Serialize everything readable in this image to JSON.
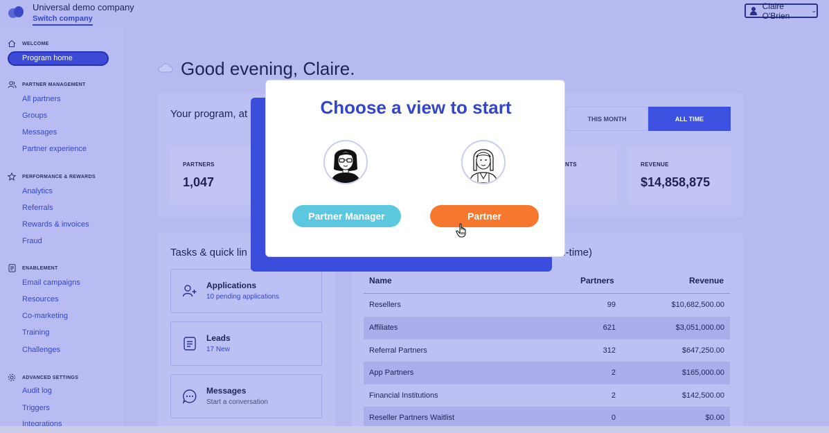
{
  "header": {
    "company_name": "Universal demo company",
    "switch_company": "Switch company",
    "user_name": "Claire O'Brien"
  },
  "sidebar": {
    "sections": [
      {
        "heading": "WELCOME",
        "icon": "home-icon",
        "items": [
          "Program home"
        ]
      },
      {
        "heading": "PARTNER MANAGEMENT",
        "icon": "users-icon",
        "items": [
          "All partners",
          "Groups",
          "Messages",
          "Partner experience"
        ]
      },
      {
        "heading": "PERFORMANCE & REWARDS",
        "icon": "star-icon",
        "items": [
          "Analytics",
          "Referrals",
          "Rewards & invoices",
          "Fraud"
        ]
      },
      {
        "heading": "ENABLEMENT",
        "icon": "document-icon",
        "items": [
          "Email campaigns",
          "Resources",
          "Co-marketing",
          "Training",
          "Challenges"
        ]
      },
      {
        "heading": "ADVANCED SETTINGS",
        "icon": "gear-icon",
        "items": [
          "Audit log",
          "Triggers",
          "Integrations"
        ]
      }
    ]
  },
  "main": {
    "greeting": "Good evening, Claire.",
    "program_title": "Your program, at",
    "tabs": {
      "month": "THIS MONTH",
      "all_time": "ALL TIME"
    },
    "stats": {
      "partners_label": "PARTNERS",
      "partners_value": "1,047",
      "clients_label": "NTS",
      "revenue_label": "REVENUE",
      "revenue_value": "$14,858,875"
    },
    "tasks_title": "Tasks & quick lin",
    "tasks": [
      {
        "title": "Applications",
        "sub": "10 pending applications",
        "icon": "add-user-icon"
      },
      {
        "title": "Leads",
        "sub": "17 New",
        "icon": "document-icon"
      },
      {
        "title": "Messages",
        "sub": "Start a conversation",
        "icon": "chat-icon"
      }
    ],
    "table_title": "ll-time)",
    "table": {
      "headers": {
        "name": "Name",
        "partners": "Partners",
        "revenue": "Revenue"
      },
      "rows": [
        {
          "name": "Resellers",
          "partners": "99",
          "revenue": "$10,682,500.00"
        },
        {
          "name": "Affiliates",
          "partners": "621",
          "revenue": "$3,051,000.00"
        },
        {
          "name": "Referral Partners",
          "partners": "312",
          "revenue": "$647,250.00"
        },
        {
          "name": "App Partners",
          "partners": "2",
          "revenue": "$165,000.00"
        },
        {
          "name": "Financial Institutions",
          "partners": "2",
          "revenue": "$142,500.00"
        },
        {
          "name": "Reseller Partners Waitlist",
          "partners": "0",
          "revenue": "$0.00"
        }
      ]
    }
  },
  "modal": {
    "title": "Choose a view to start",
    "partner_manager": "Partner Manager",
    "partner": "Partner"
  },
  "colors": {
    "accent": "#3346c8",
    "partner_manager_button": "#5bc8e0",
    "partner_button": "#f5782e"
  }
}
